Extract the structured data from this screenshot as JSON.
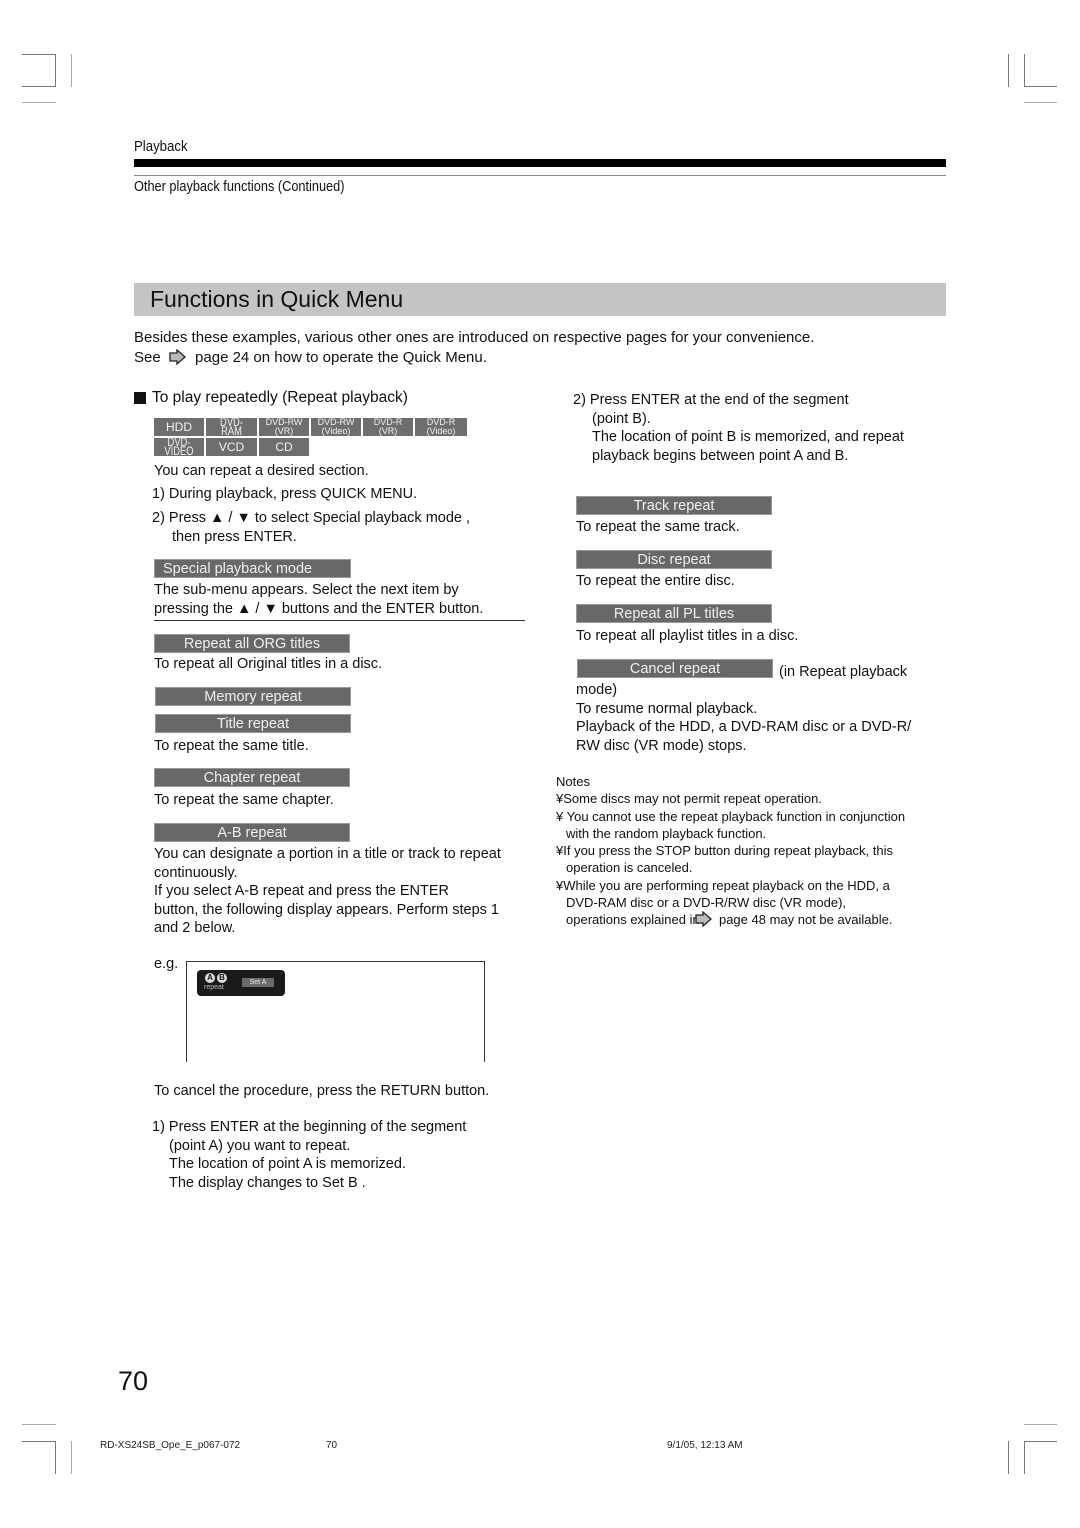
{
  "header": {
    "running_head": "Playback",
    "sub_head": "Other playback functions (Continued)"
  },
  "title": "Functions in Quick Menu",
  "intro": {
    "line1": "Besides these examples, various other ones are introduced on respective pages for your convenience.",
    "line2_pre": "See",
    "line2_icon": "arrow-right-icon",
    "line2_post": "page 24 on how to operate the Quick Menu."
  },
  "section": {
    "heading": "To play repeatedly (Repeat playback)",
    "disc_badges_row1": [
      {
        "top": "HDD",
        "bottom": ""
      },
      {
        "top": "DVD-RAM",
        "bottom": ""
      },
      {
        "top": "DVD-RW",
        "bottom": "(VR)"
      },
      {
        "top": "DVD-RW",
        "bottom": "(Video)"
      },
      {
        "top": "DVD-R",
        "bottom": "(VR)"
      },
      {
        "top": "DVD-R",
        "bottom": "(Video)"
      }
    ],
    "disc_badges_row2": [
      "DVD-VIDEO",
      "VCD",
      "CD"
    ],
    "desc": "You can repeat a desired section.",
    "step1": "1)  During playback, press QUICK MENU.",
    "step2_a": "2)  Press ▲ / ▼ to select  Special playback mode ,",
    "step2_b": "then press ENTER.",
    "special_mode_label": "Special playback mode",
    "submenu_a": "The sub-menu appears. Select the next item by",
    "submenu_b": "pressing the ▲ / ▼ buttons and the ENTER button."
  },
  "menu_items": {
    "org": {
      "label": "Repeat all ORG titles",
      "desc": "To repeat all Original titles in a disc."
    },
    "memory": {
      "label": "Memory repeat"
    },
    "title": {
      "label": "Title repeat",
      "desc": "To repeat the same title."
    },
    "chapter": {
      "label": "Chapter repeat",
      "desc": "To repeat the same chapter."
    },
    "ab": {
      "label": "A-B repeat",
      "desc": [
        "You can designate a portion in a title or track to repeat",
        "continuously.",
        "If you select  A-B repeat  and press the ENTER",
        "button, the following display appears. Perform steps 1",
        "and 2 below."
      ]
    },
    "track": {
      "label": "Track repeat",
      "desc": "To repeat the same track."
    },
    "disc": {
      "label": "Disc repeat",
      "desc": "To repeat the entire disc."
    },
    "pl": {
      "label": "Repeat all PL titles",
      "desc": "To repeat all playlist titles in a disc."
    },
    "cancel": {
      "label": "Cancel repeat",
      "suffix": "(in Repeat playback",
      "desc": [
        "mode)",
        "To resume normal playback.",
        "Playback of the HDD, a DVD-RAM disc or a DVD-R/",
        "RW disc (VR mode) stops."
      ]
    }
  },
  "example": {
    "label": "e.g.",
    "osd_a": "A",
    "osd_b": "B",
    "osd_repeat": "repeat",
    "osd_status": "Set A"
  },
  "cancel_note": "To cancel the procedure, press the RETURN button.",
  "ab_steps": {
    "step1": [
      "1) Press ENTER at the beginning of the segment",
      "(point A) you want to repeat.",
      "The location of point A is memorized.",
      "The display changes to  Set B ."
    ],
    "step2": [
      "2) Press ENTER at the end of the segment",
      "(point B).",
      "The location of point B is memorized, and repeat",
      "playback begins between point A and B."
    ]
  },
  "notes": {
    "heading": "Notes",
    "items": [
      [
        "¥Some discs may not permit repeat operation."
      ],
      [
        "¥ You cannot use the repeat playback function in conjunction",
        "with the random playback function."
      ],
      [
        "¥If you press the STOP button during repeat playback, this",
        "operation is canceled."
      ],
      [
        "¥While you are performing repeat playback on the HDD, a",
        "DVD-RAM disc or a DVD-R/RW disc (VR mode),"
      ]
    ],
    "last_pre": "operations explained in",
    "last_post": "page 48 may not be available."
  },
  "page_number": "70",
  "footer": {
    "file": "RD-XS24SB_Ope_E_p067-072",
    "page": "70",
    "timestamp": "9/1/05, 12:13 AM"
  }
}
